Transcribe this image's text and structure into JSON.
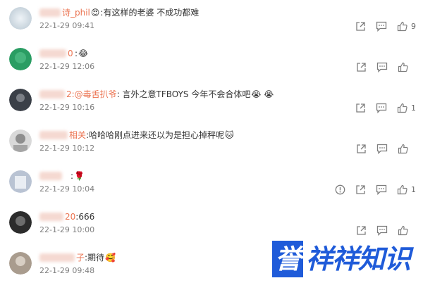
{
  "comments": [
    {
      "name": "诗_phil",
      "emoji_before": "😍",
      "text": ":有这样的老婆 不成功都难",
      "emoji_after": "",
      "time": "22-1-29 09:41",
      "likes": "9",
      "show_report": false,
      "show_share": true
    },
    {
      "name": "0",
      "emoji_before": "",
      "text": ":",
      "emoji_after": "😂",
      "time": "22-1-29 12:06",
      "likes": "",
      "show_report": false,
      "show_share": true
    },
    {
      "name": "2:@毒舌扒爷",
      "emoji_before": "",
      "text": ": 言外之意TFBOYS 今年不会合体吧",
      "emoji_after": "😭 😭",
      "time": "22-1-29 10:16",
      "likes": "1",
      "show_report": false,
      "show_share": true
    },
    {
      "name": "相关",
      "emoji_before": "",
      "text": ":哈哈哈刚点进来还以为是担心掉秤呢",
      "emoji_after": "🐱",
      "time": "22-1-29 10:12",
      "likes": "",
      "show_report": false,
      "show_share": true
    },
    {
      "name": "",
      "emoji_before": "",
      "text": ": ",
      "emoji_after": "🌹",
      "time": "22-1-29 10:04",
      "likes": "1",
      "show_report": true,
      "show_share": true
    },
    {
      "name": "20",
      "emoji_before": "",
      "text": ":666",
      "emoji_after": "",
      "time": "22-1-29 10:00",
      "likes": "",
      "show_report": false,
      "show_share": true
    },
    {
      "name": "子",
      "emoji_before": "",
      "text": ":期待",
      "emoji_after": "🥰",
      "time": "22-1-29 09:48",
      "likes": "",
      "show_report": false,
      "show_share": false
    }
  ],
  "watermark": {
    "box": "誉",
    "text": "祥祥知识"
  },
  "colors": {
    "name": "#eb7350",
    "icon": "#7d7d7d",
    "brand": "#1f5bd9"
  }
}
